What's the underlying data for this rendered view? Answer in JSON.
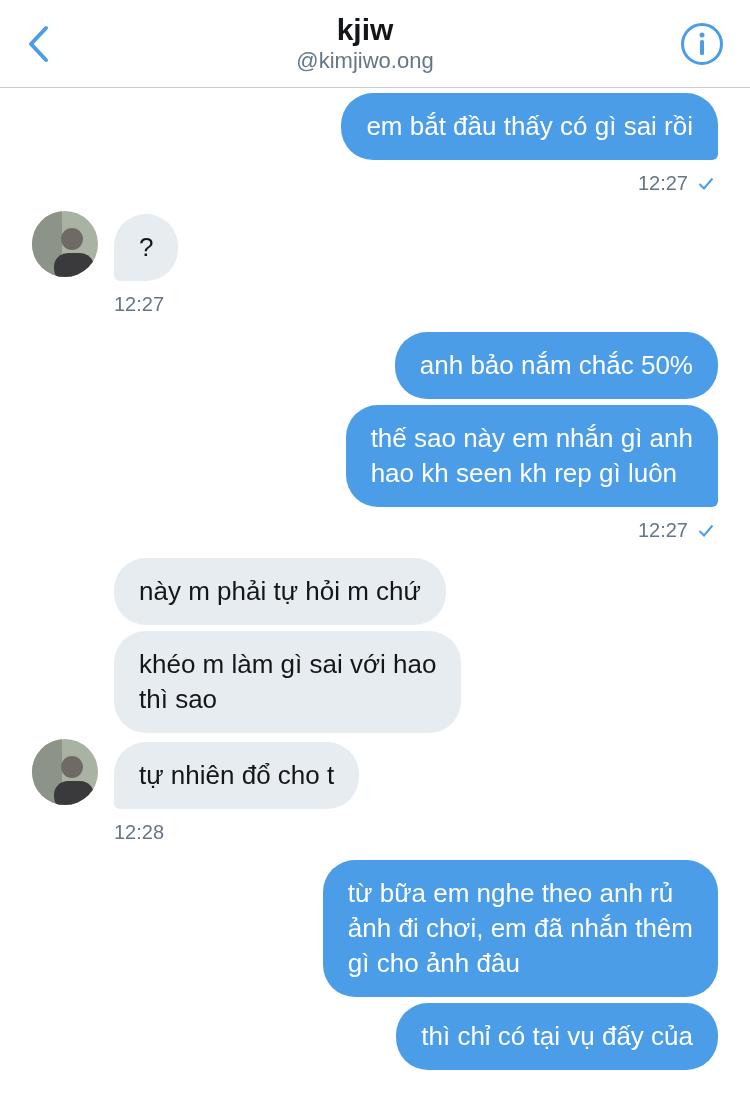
{
  "header": {
    "title": "kjiw",
    "handle": "@kimjiwo.ong"
  },
  "groups": [
    {
      "kind": "sent",
      "bubbles": [
        "em bắt đầu thấy có gì sai rồi"
      ],
      "time": "12:27",
      "seen": true
    },
    {
      "kind": "received",
      "bubbles": [
        "?"
      ],
      "time": "12:27"
    },
    {
      "kind": "sent",
      "bubbles": [
        "anh bảo nắm chắc 50%",
        "thế sao này em nhắn gì anh\nhao kh seen kh rep gì luôn"
      ],
      "time": "12:27",
      "seen": true
    },
    {
      "kind": "received",
      "bubbles": [
        "này m phải tự hỏi m chứ",
        "khéo m làm gì sai với hao\nthì sao",
        "tự nhiên đổ cho t"
      ],
      "time": "12:28"
    },
    {
      "kind": "sent",
      "bubbles": [
        "từ bữa em nghe theo anh rủ\nảnh đi chơi, em đã nhắn thêm\ngì cho ảnh đâu",
        "thì chỉ có tại vụ đấy của"
      ]
    }
  ]
}
